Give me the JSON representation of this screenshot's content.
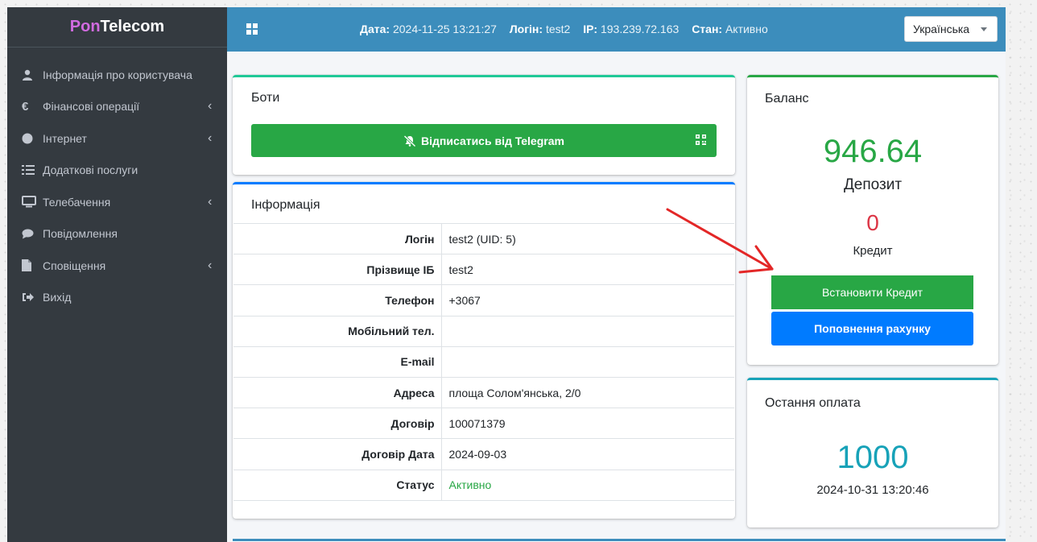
{
  "brand": {
    "part1": "Pon",
    "part2": "Telecom"
  },
  "sidebar": {
    "items": [
      {
        "label": "Інформація про користувача",
        "icon": "user-icon",
        "has_submenu": false
      },
      {
        "label": "Фінансові операції",
        "icon": "euro-icon",
        "has_submenu": true
      },
      {
        "label": "Інтернет",
        "icon": "circle-icon",
        "has_submenu": true
      },
      {
        "label": "Додаткові послуги",
        "icon": "list-icon",
        "has_submenu": false
      },
      {
        "label": "Телебачення",
        "icon": "monitor-icon",
        "has_submenu": true
      },
      {
        "label": "Повідомлення",
        "icon": "comment-icon",
        "has_submenu": false
      },
      {
        "label": "Сповіщення",
        "icon": "file-icon",
        "has_submenu": true
      },
      {
        "label": "Вихід",
        "icon": "sign-out-icon",
        "has_submenu": false
      }
    ]
  },
  "topbar": {
    "date_label": "Дата:",
    "date_value": "2024-11-25 13:21:27",
    "login_label": "Логін:",
    "login_value": "test2",
    "ip_label": "IP:",
    "ip_value": "193.239.72.163",
    "status_label": "Стан:",
    "status_value": "Активно",
    "language": "Українська"
  },
  "bots": {
    "title": "Боти",
    "telegram_button": "Відписатись від Telegram"
  },
  "info": {
    "title": "Інформація",
    "rows": [
      {
        "key": "Логін",
        "value": "test2 (UID: 5)"
      },
      {
        "key": "Прізвище ІБ",
        "value": "test2"
      },
      {
        "key": "Телефон",
        "value": "+3067"
      },
      {
        "key": "Мобільний тел.",
        "value": ""
      },
      {
        "key": "E-mail",
        "value": ""
      },
      {
        "key": "Адреса",
        "value": "площа Солом'янська, 2/0"
      },
      {
        "key": "Договір",
        "value": "100071379"
      },
      {
        "key": "Договір Дата",
        "value": "2024-09-03"
      },
      {
        "key": "Статус",
        "value": "Активно"
      }
    ]
  },
  "balance": {
    "title": "Баланс",
    "deposit_value": "946.64",
    "deposit_label": "Депозит",
    "credit_value": "0",
    "credit_label": "Кредит",
    "set_credit_button": "Встановити Кредит",
    "topup_button": "Поповнення рахунку"
  },
  "last_payment": {
    "title": "Остання оплата",
    "amount": "1000",
    "date": "2024-10-31 13:20:46"
  },
  "colors": {
    "sidebar_bg": "#343a40",
    "topbar_bg": "#3c8dbc",
    "success": "#28a745",
    "primary": "#007bff",
    "info": "#17a2b8",
    "danger": "#dc3545",
    "annotation_arrow": "#e32727"
  }
}
